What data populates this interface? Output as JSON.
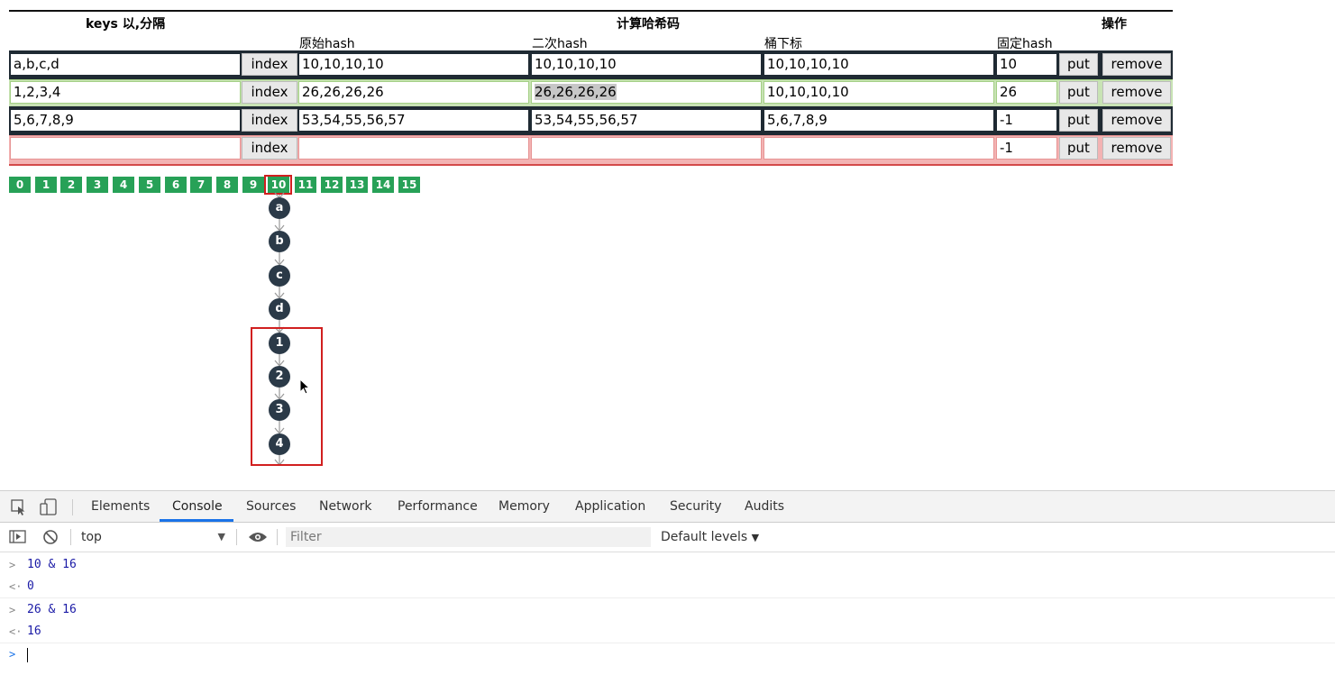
{
  "table": {
    "headers": {
      "keys": "keys 以,分隔",
      "compute": "计算哈希码",
      "ops": "操作"
    },
    "subheaders": {
      "raw_hash": "原始hash",
      "second_hash": "二次hash",
      "bucket_index": "桶下标",
      "fixed_hash": "固定hash"
    },
    "rows": [
      {
        "keys": "a,b,c,d",
        "index_label": "index",
        "raw_hash": "10,10,10,10",
        "second_hash": "10,10,10,10",
        "bucket_index": "10,10,10,10",
        "fixed_hash": "10",
        "put_label": "put",
        "remove_label": "remove"
      },
      {
        "keys": "1,2,3,4",
        "index_label": "index",
        "raw_hash": "26,26,26,26",
        "second_hash": "26,26,26,26",
        "bucket_index": "10,10,10,10",
        "fixed_hash": "26",
        "put_label": "put",
        "remove_label": "remove"
      },
      {
        "keys": "5,6,7,8,9",
        "index_label": "index",
        "raw_hash": "53,54,55,56,57",
        "second_hash": "53,54,55,56,57",
        "bucket_index": "5,6,7,8,9",
        "fixed_hash": "-1",
        "put_label": "put",
        "remove_label": "remove"
      },
      {
        "keys": "",
        "index_label": "index",
        "raw_hash": "",
        "second_hash": "",
        "bucket_index": "",
        "fixed_hash": "-1",
        "put_label": "put",
        "remove_label": "remove"
      }
    ]
  },
  "buckets": [
    "0",
    "1",
    "2",
    "3",
    "4",
    "5",
    "6",
    "7",
    "8",
    "9",
    "10",
    "11",
    "12",
    "13",
    "14",
    "15"
  ],
  "selected_bucket": "10",
  "chain_nodes": [
    "a",
    "b",
    "c",
    "d",
    "1",
    "2",
    "3",
    "4"
  ],
  "colors": {
    "bucket": "#27a157",
    "node": "#2b3a48",
    "highlight": "#d11f1f"
  },
  "devtools": {
    "tabs": [
      "Elements",
      "Console",
      "Sources",
      "Network",
      "Performance",
      "Memory",
      "Application",
      "Security",
      "Audits"
    ],
    "active_tab": "Console",
    "context": "top",
    "filter_placeholder": "Filter",
    "levels": "Default levels",
    "console_lines": [
      {
        "type": "input",
        "text": "10 & 16"
      },
      {
        "type": "result",
        "text": "0"
      },
      {
        "type": "input",
        "text": "26 & 16"
      },
      {
        "type": "result",
        "text": "16"
      }
    ]
  }
}
